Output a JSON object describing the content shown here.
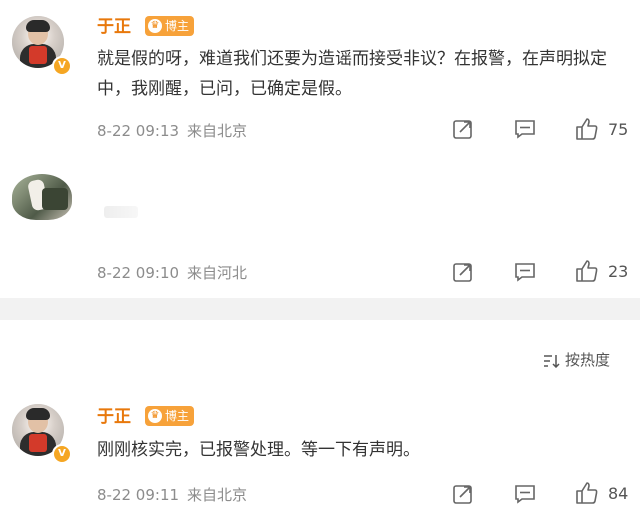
{
  "comments": [
    {
      "name": "于正",
      "badge": "博主",
      "text": "就是假的呀，难道我们还要为造谣而接受非议？在报警，在声明拟定中，我刚醒，已问，已确定是假。",
      "time": "8-22 09:13",
      "location": "来自北京",
      "likes": "75"
    },
    {
      "name": "",
      "text": "",
      "time": "8-22 09:10",
      "location": "来自河北",
      "likes": "23"
    },
    {
      "name": "于正",
      "badge": "博主",
      "text": "刚刚核实完，已报警处理。等一下有声明。",
      "time": "8-22 09:11",
      "location": "来自北京",
      "likes": "84"
    }
  ],
  "sort": {
    "label": "按热度"
  },
  "icons": {
    "share": "share-icon",
    "comment": "comment-icon",
    "like": "thumb-up-icon",
    "verified": "verified-icon",
    "sort": "sort-icon"
  },
  "colors": {
    "username": "#e8780b",
    "badge": "#f7a23a",
    "meta": "#8c8c8c",
    "divider": "#f2f2f2"
  }
}
